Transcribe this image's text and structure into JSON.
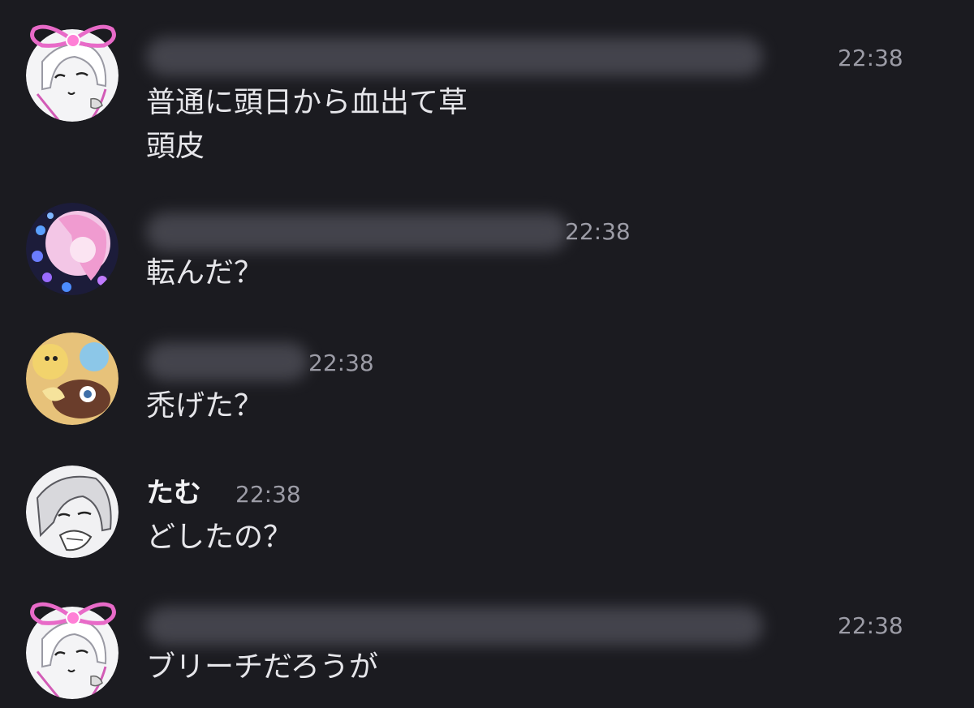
{
  "messages": [
    {
      "author": "",
      "time": "22:38",
      "lines": [
        "普通に頭日から血出て草",
        "頭皮"
      ]
    },
    {
      "author": "",
      "time": "22:38",
      "lines": [
        "転んだ？"
      ]
    },
    {
      "author": "",
      "time": "22:38",
      "lines": [
        "禿げた？"
      ]
    },
    {
      "author": "たむ",
      "time": "22:38",
      "lines": [
        "どしたの？"
      ]
    },
    {
      "author": "",
      "time": "22:38",
      "lines": [
        "ブリーチだろうが"
      ]
    }
  ],
  "colors": {
    "background": "#1b1b20",
    "message_text": "#e6e6ea",
    "timestamp": "#9c9ca6",
    "author_name": "#f3f3f5",
    "ribbon_pink": "#e86ac8"
  },
  "icons": [
    "avatar-ribbon-girl",
    "avatar-pink-hair-flowers",
    "avatar-psyduck-group",
    "avatar-sketch-girl"
  ]
}
